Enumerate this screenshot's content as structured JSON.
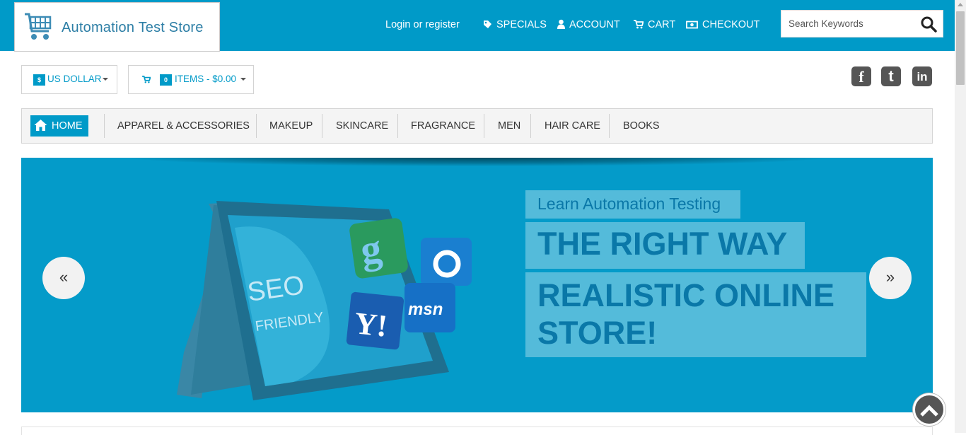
{
  "header": {
    "logo_text": "Automation Test Store",
    "login_text": "Login or register",
    "links": [
      {
        "label": "SPECIALS",
        "icon": "tag-icon"
      },
      {
        "label": "ACCOUNT",
        "icon": "user-icon"
      },
      {
        "label": "CART",
        "icon": "cart-icon"
      },
      {
        "label": "CHECKOUT",
        "icon": "money-icon"
      }
    ],
    "search_placeholder": "Search Keywords"
  },
  "toolbar": {
    "currency_symbol": "$",
    "currency_label": "US DOLLAR",
    "cart_count": "0",
    "cart_label": "ITEMS - $0.00"
  },
  "social": [
    {
      "name": "facebook",
      "glyph": "f"
    },
    {
      "name": "twitter",
      "glyph": "t"
    },
    {
      "name": "linkedin",
      "glyph": "in"
    }
  ],
  "nav": {
    "home": "HOME",
    "items": [
      "APPAREL & ACCESSORIES",
      "MAKEUP",
      "SKINCARE",
      "FRAGRANCE",
      "MEN",
      "HAIR CARE",
      "BOOKS"
    ]
  },
  "banner": {
    "caption_small": "Learn Automation Testing",
    "caption_big1": "THE RIGHT WAY",
    "caption_big2": "REALISTIC ONLINE STORE!",
    "image_text_seo": "SEO",
    "image_text_friendly": "FRIENDLY",
    "image_text_msn": "msn",
    "image_text_yahoo": "Y!",
    "prev_glyph": "«",
    "next_glyph": "»"
  },
  "colors": {
    "brand": "#009ac8",
    "banner": "#049bc9",
    "caption_text": "#0a78a8"
  }
}
